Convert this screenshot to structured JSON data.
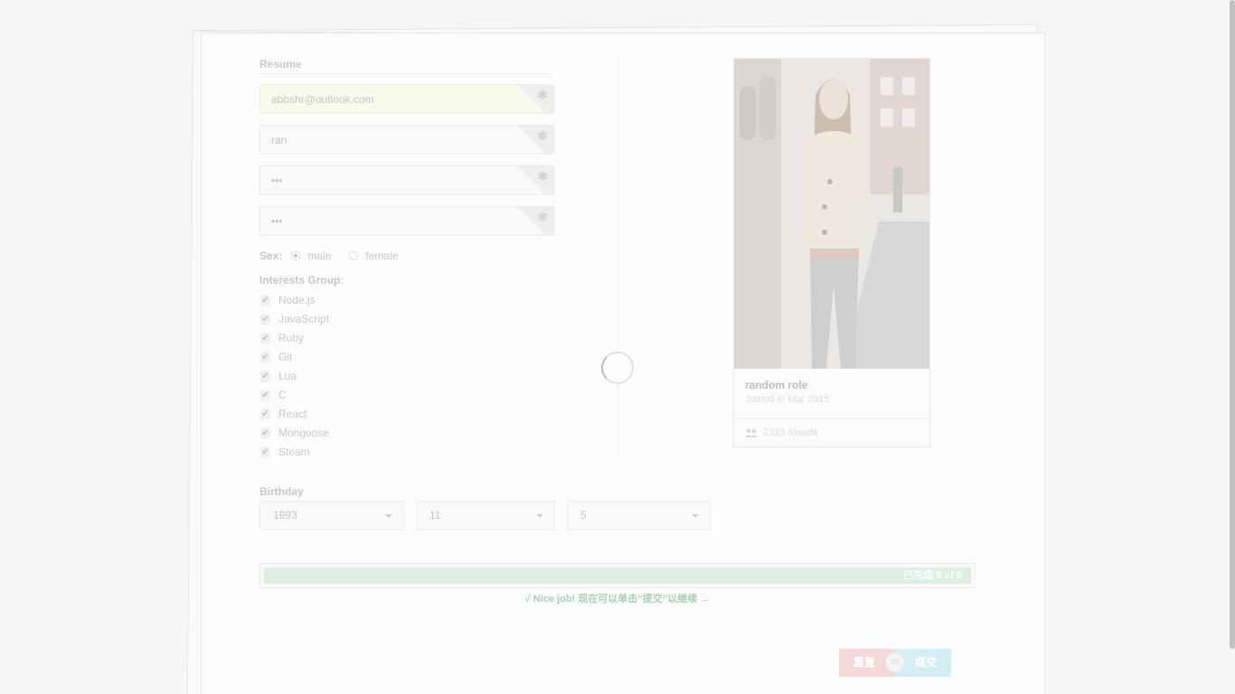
{
  "form": {
    "title": "Resume",
    "fields": [
      {
        "name": "email",
        "value": "abbshr@outlook.com",
        "required_mark": "✱"
      },
      {
        "name": "username",
        "value": "ran",
        "required_mark": "✱"
      },
      {
        "name": "password",
        "value": "•••",
        "required_mark": "✱"
      },
      {
        "name": "password-confirm",
        "value": "•••",
        "required_mark": "✱"
      }
    ],
    "sex": {
      "label": "Sex:",
      "options": [
        "male",
        "female"
      ],
      "selected": "male"
    },
    "interests": {
      "title": "Interests Group:",
      "items": [
        "Node.js",
        "JavaScript",
        "Ruby",
        "Git",
        "Lua",
        "C",
        "React",
        "Mongoose",
        "Steam"
      ],
      "check_mark": "✔"
    },
    "birthday": {
      "title": "Birthday",
      "year": "1993",
      "month": "11",
      "day": "5"
    }
  },
  "profile": {
    "name": "random role",
    "joined": "Joined in Mar 2015",
    "friends": "2333 friends",
    "friends_icon": "users-icon"
  },
  "progress": {
    "fraction": 1.0,
    "text": "已完成 8 of 8",
    "message": "√ Nice job! 现在可以单击“提交”以继续 →",
    "fill_color": "#ddeee2"
  },
  "actions": {
    "reset_label": "重置",
    "or_label": "or",
    "submit_label": "提交",
    "reset_color": "#f4d9da",
    "submit_color": "#d3eff3"
  }
}
